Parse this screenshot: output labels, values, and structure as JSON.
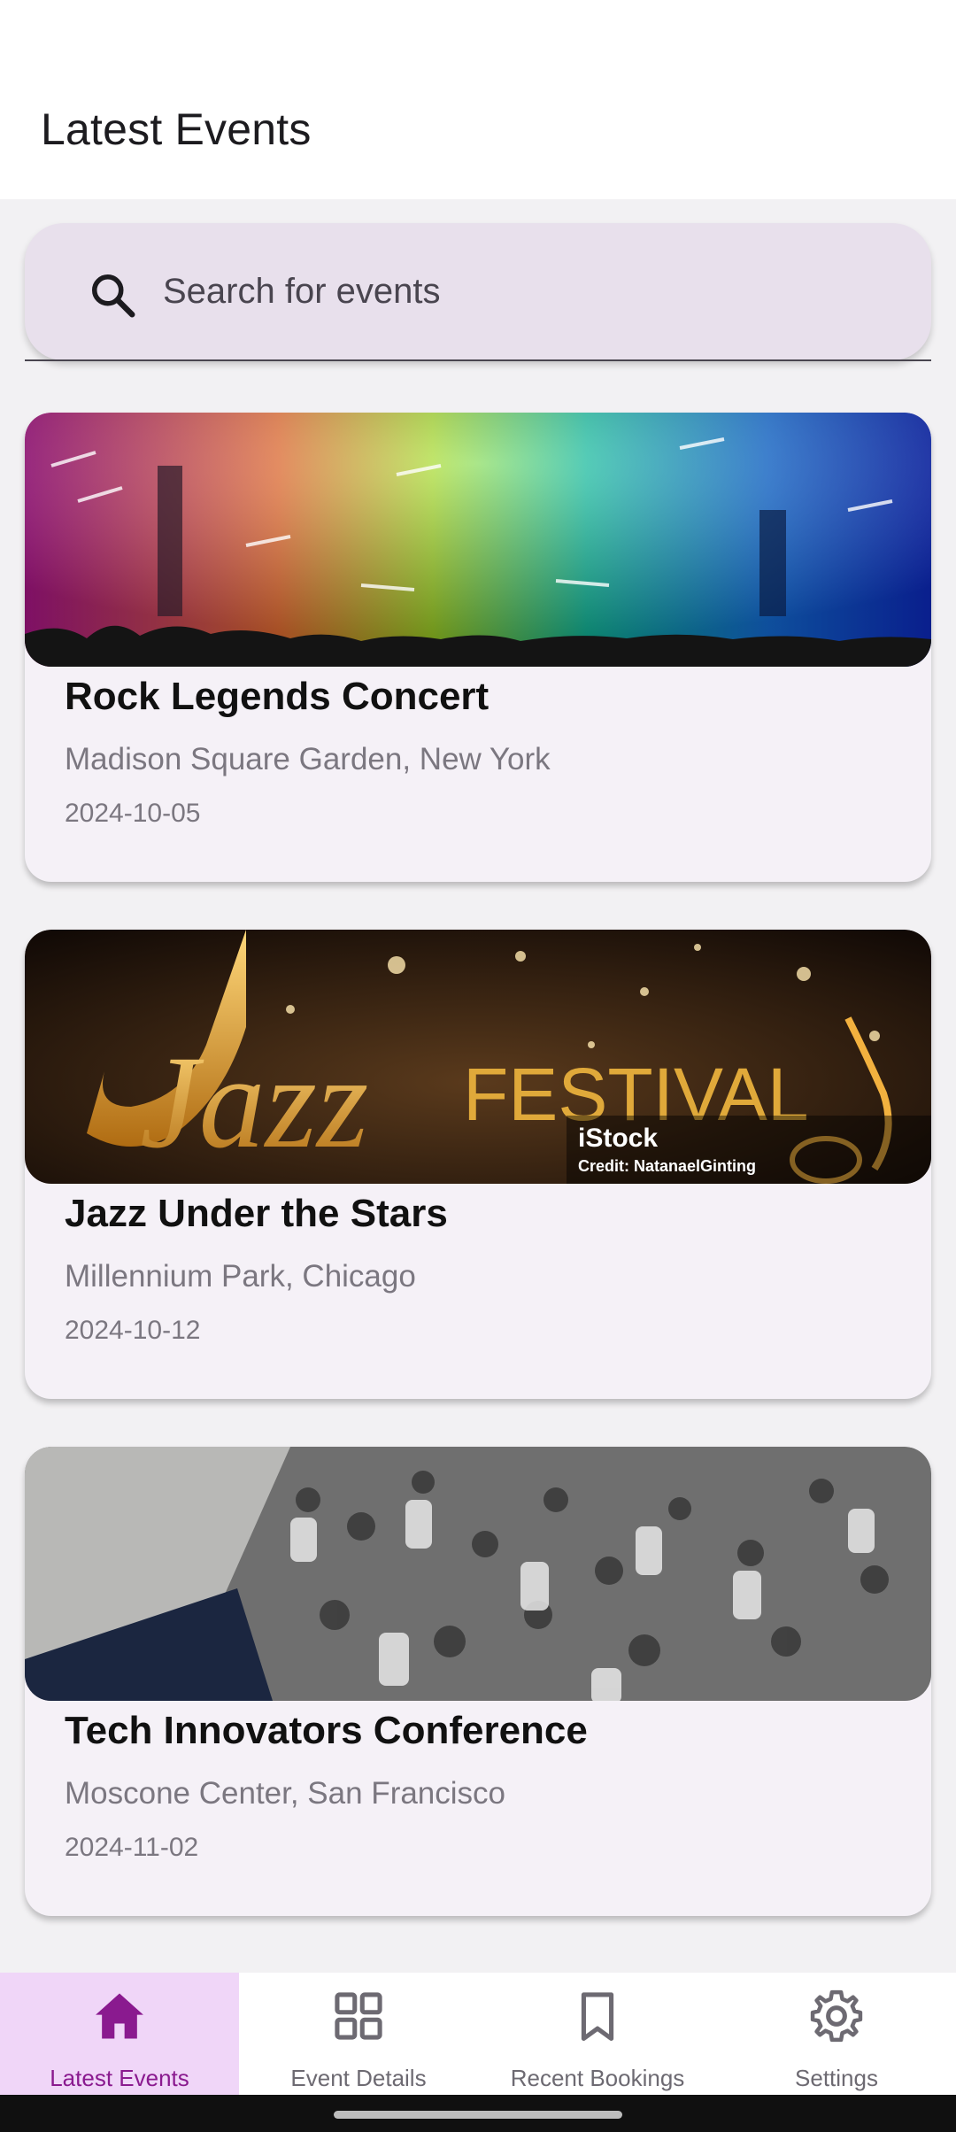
{
  "app": {
    "title": "Latest Events"
  },
  "search": {
    "placeholder": "Search for events",
    "icon": "search-icon"
  },
  "events": [
    {
      "title": "Rock Legends Concert",
      "venue": "Madison Square Garden, New York",
      "date": "2024-10-05",
      "image": "concert-crowd-lights"
    },
    {
      "title": "Jazz Under the Stars",
      "venue": "Millennium Park, Chicago",
      "date": "2024-10-12",
      "image": "jazz-festival-banner",
      "image_text": {
        "word1": "Jazz",
        "word2": "FESTIVAL",
        "watermark": "iStock",
        "credit": "Credit: NatanaelGinting"
      }
    },
    {
      "title": "Tech Innovators Conference",
      "venue": "Moscone Center, San Francisco",
      "date": "2024-11-02",
      "image": "conference-crowd"
    }
  ],
  "nav": {
    "active": "Latest Events",
    "items": [
      {
        "label": "Latest Events",
        "icon": "home-icon"
      },
      {
        "label": "Event Details",
        "icon": "grid-icon"
      },
      {
        "label": "Recent Bookings",
        "icon": "bookmark-icon"
      },
      {
        "label": "Settings",
        "icon": "gear-icon"
      }
    ]
  },
  "colors": {
    "accent": "#8a1a8f",
    "active_nav_bg": "#f0d6f8",
    "search_bg": "#e8e0ec",
    "card_bg": "#f5f1f7"
  }
}
